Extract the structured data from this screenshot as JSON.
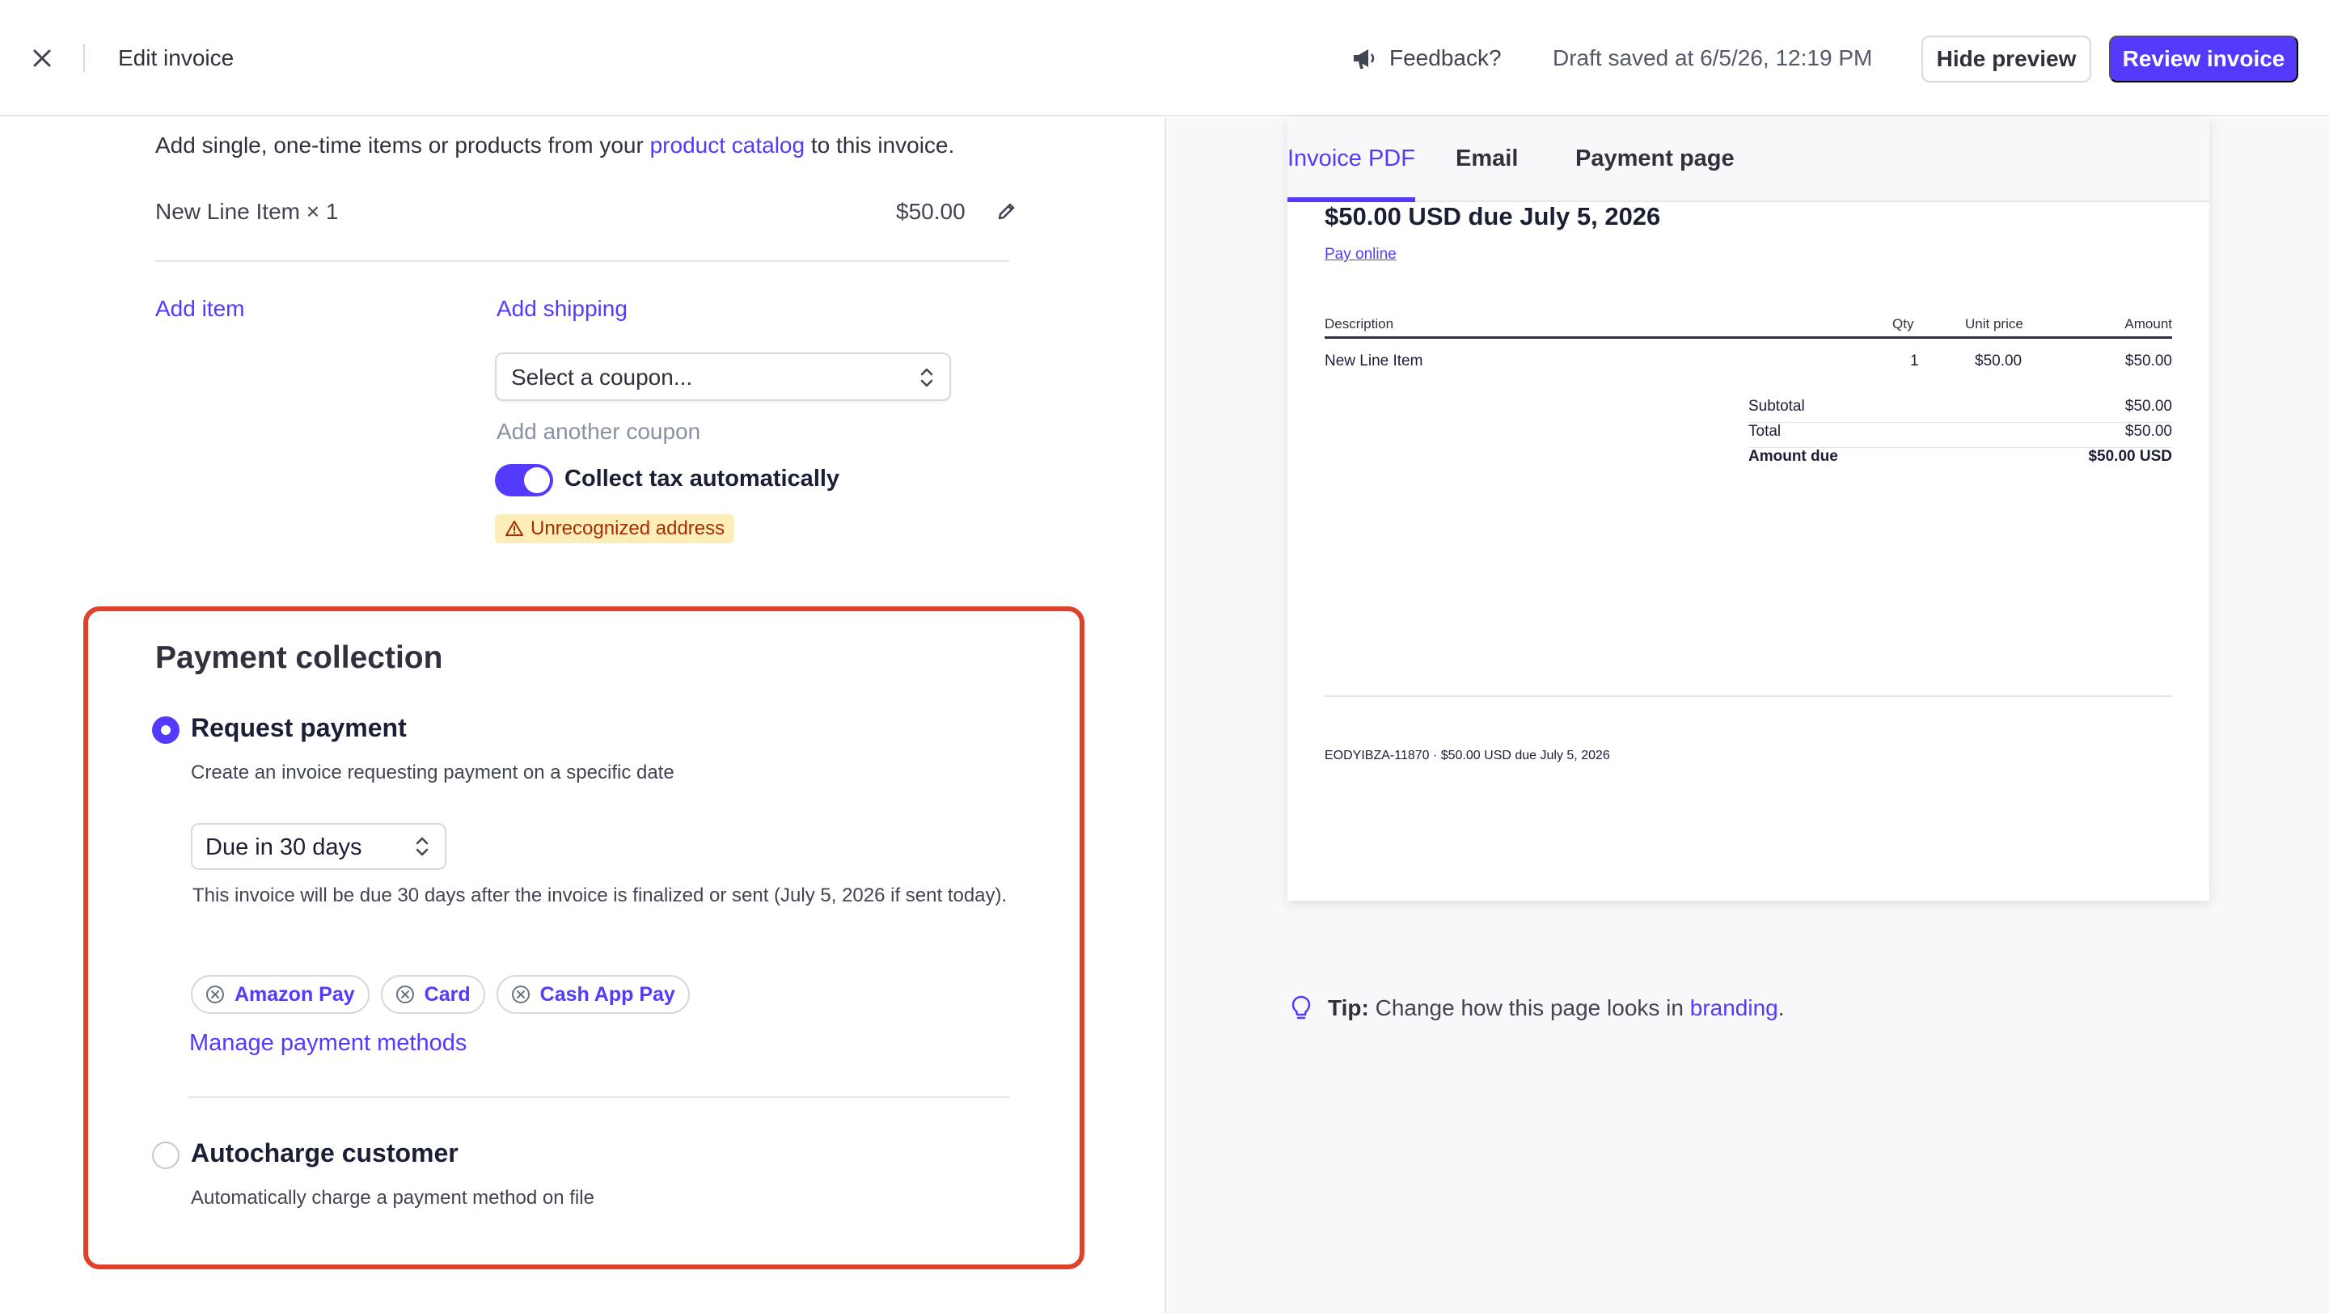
{
  "header": {
    "title": "Edit invoice",
    "feedback_label": "Feedback?",
    "draft_status": "Draft saved at 6/5/26, 12:19 PM",
    "hide_preview_label": "Hide preview",
    "review_label": "Review invoice"
  },
  "items": {
    "description_prefix": "Add single, one-time items or products from your",
    "catalog_link": "product catalog",
    "description_suffix": "to this invoice.",
    "line_item_name": "New Line Item × 1",
    "line_item_amount": "$50.00",
    "add_item_label": "Add item",
    "add_shipping_label": "Add shipping",
    "coupon_placeholder": "Select a coupon...",
    "add_coupon_label": "Add another coupon",
    "tax_toggle_label": "Collect tax automatically",
    "tax_toggle_on": true,
    "warning_badge": "Unrecognized address"
  },
  "payment_collection": {
    "title": "Payment collection",
    "request": {
      "title": "Request payment",
      "description": "Create an invoice requesting payment on a specific date",
      "due_selected": "Due in 30 days",
      "due_note": "This invoice will be due 30 days after the invoice is finalized or sent (July 5, 2026 if sent today).",
      "methods": [
        "Amazon Pay",
        "Card",
        "Cash App Pay"
      ],
      "manage_label": "Manage payment methods"
    },
    "autocharge": {
      "title": "Autocharge customer",
      "description": "Automatically charge a payment method on file"
    },
    "selected": "request"
  },
  "preview": {
    "tabs": [
      "Invoice PDF",
      "Email",
      "Payment page"
    ],
    "active_tab": "Invoice PDF",
    "heading": "$50.00 USD due July 5, 2026",
    "pay_online": "Pay online",
    "table_headers": {
      "description": "Description",
      "qty": "Qty",
      "unit_price": "Unit price",
      "amount": "Amount"
    },
    "rows": [
      {
        "description": "New Line Item",
        "qty": "1",
        "unit_price": "$50.00",
        "amount": "$50.00"
      }
    ],
    "summary": [
      {
        "label": "Subtotal",
        "value": "$50.00"
      },
      {
        "label": "Total",
        "value": "$50.00"
      },
      {
        "label": "Amount due",
        "value": "$50.00 USD"
      }
    ],
    "footer": "EODYIBZA-11870 · $50.00 USD due July 5, 2026"
  },
  "tip": {
    "label": "Tip:",
    "text": "Change how this page looks in",
    "link": "branding",
    "suffix": "."
  },
  "colors": {
    "accent": "#533afd",
    "highlight_border": "#e0412a",
    "warning_bg": "#fcedb9",
    "warning_text": "#a82c00"
  }
}
